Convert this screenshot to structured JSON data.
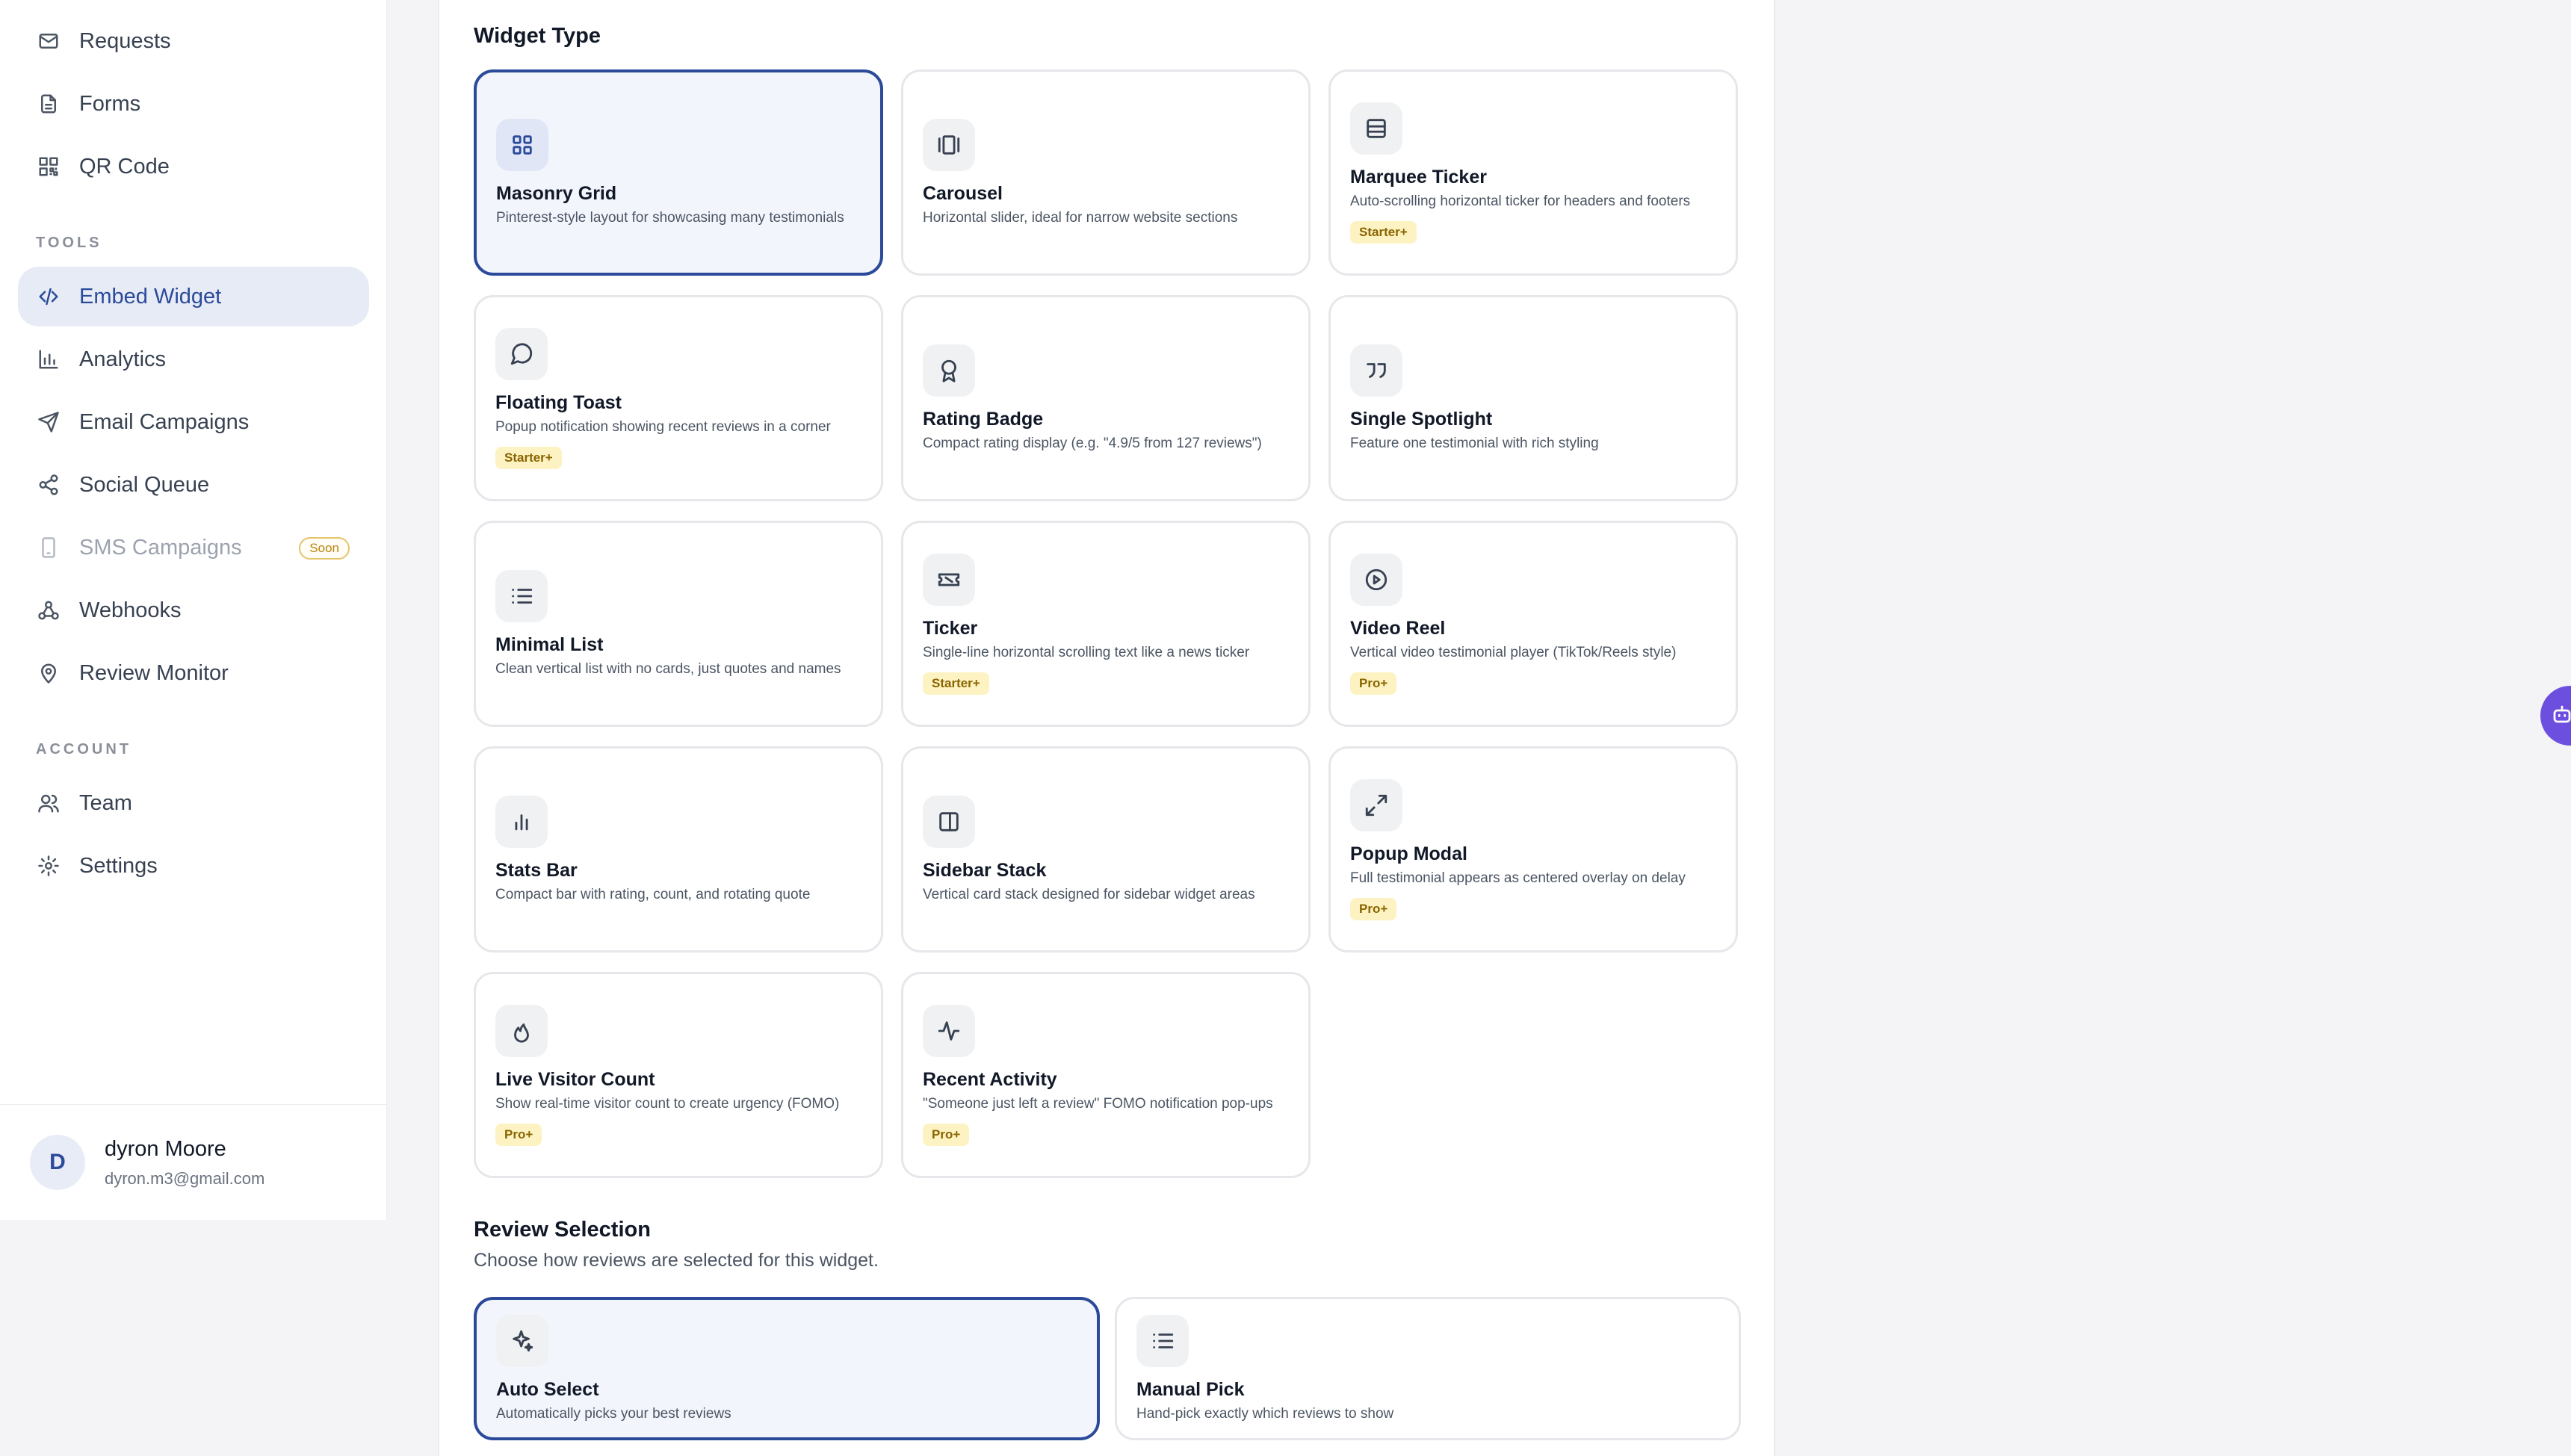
{
  "sidebar": {
    "top_items": [
      {
        "label": "Requests",
        "icon": "mail-icon"
      },
      {
        "label": "Forms",
        "icon": "file-text-icon"
      },
      {
        "label": "QR Code",
        "icon": "qr-code-icon"
      }
    ],
    "tools_label": "TOOLS",
    "tools": [
      {
        "label": "Embed Widget",
        "icon": "code-icon",
        "active": true
      },
      {
        "label": "Analytics",
        "icon": "bar-chart-icon"
      },
      {
        "label": "Email Campaigns",
        "icon": "send-icon"
      },
      {
        "label": "Social Queue",
        "icon": "share-icon"
      },
      {
        "label": "SMS Campaigns",
        "icon": "smartphone-icon",
        "disabled": true,
        "badge": "Soon"
      },
      {
        "label": "Webhooks",
        "icon": "webhook-icon"
      },
      {
        "label": "Review Monitor",
        "icon": "map-pin-icon"
      }
    ],
    "account_label": "ACCOUNT",
    "account": [
      {
        "label": "Team",
        "icon": "users-icon"
      },
      {
        "label": "Settings",
        "icon": "gear-icon"
      }
    ],
    "user": {
      "initial": "D",
      "name": "dyron Moore",
      "email": "dyron.m3@gmail.com"
    }
  },
  "widget_type": {
    "heading": "Widget Type",
    "options": [
      {
        "title": "Masonry Grid",
        "desc": "Pinterest-style layout for showcasing many testimonials",
        "icon": "grid-icon",
        "selected": true
      },
      {
        "title": "Carousel",
        "desc": "Horizontal slider, ideal for narrow website sections",
        "icon": "carousel-icon"
      },
      {
        "title": "Marquee Ticker",
        "desc": "Auto-scrolling horizontal ticker for headers and footers",
        "icon": "rows-icon",
        "tier": "Starter+"
      },
      {
        "title": "Floating Toast",
        "desc": "Popup notification showing recent reviews in a corner",
        "icon": "message-circle-icon",
        "tier": "Starter+"
      },
      {
        "title": "Rating Badge",
        "desc": "Compact rating display (e.g. \"4.9/5 from 127 reviews\")",
        "icon": "award-icon"
      },
      {
        "title": "Single Spotlight",
        "desc": "Feature one testimonial with rich styling",
        "icon": "quote-icon"
      },
      {
        "title": "Minimal List",
        "desc": "Clean vertical list with no cards, just quotes and names",
        "icon": "list-icon"
      },
      {
        "title": "Ticker",
        "desc": "Single-line horizontal scrolling text like a news ticker",
        "icon": "ticket-icon",
        "tier": "Starter+"
      },
      {
        "title": "Video Reel",
        "desc": "Vertical video testimonial player (TikTok/Reels style)",
        "icon": "play-circle-icon",
        "tier": "Pro+"
      },
      {
        "title": "Stats Bar",
        "desc": "Compact bar with rating, count, and rotating quote",
        "icon": "bar-chart-icon"
      },
      {
        "title": "Sidebar Stack",
        "desc": "Vertical card stack designed for sidebar widget areas",
        "icon": "panel-right-icon"
      },
      {
        "title": "Popup Modal",
        "desc": "Full testimonial appears as centered overlay on delay",
        "icon": "expand-icon",
        "tier": "Pro+"
      },
      {
        "title": "Live Visitor Count",
        "desc": "Show real-time visitor count to create urgency (FOMO)",
        "icon": "flame-icon",
        "tier": "Pro+"
      },
      {
        "title": "Recent Activity",
        "desc": "\"Someone just left a review\" FOMO notification pop-ups",
        "icon": "activity-icon",
        "tier": "Pro+"
      }
    ]
  },
  "review_selection": {
    "heading": "Review Selection",
    "subtitle": "Choose how reviews are selected for this widget.",
    "options": [
      {
        "title": "Auto Select",
        "desc": "Automatically picks your best reviews",
        "icon": "sparkles-icon",
        "selected": true
      },
      {
        "title": "Manual Pick",
        "desc": "Hand-pick exactly which reviews to show",
        "icon": "list-icon"
      }
    ]
  },
  "colors": {
    "accent": "#2b4a9a",
    "selected_bg": "#f3f5fc",
    "tier_bg": "#fdf3c2",
    "fab": "#6d4fe0"
  }
}
